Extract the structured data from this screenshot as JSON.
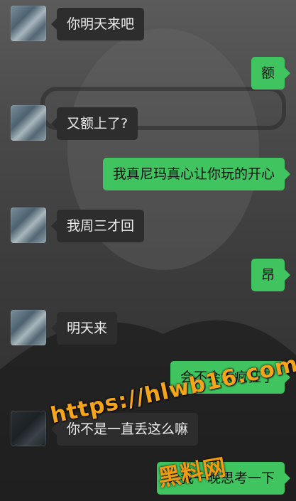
{
  "messages": [
    {
      "side": "in",
      "text": "你明天来吧"
    },
    {
      "side": "out",
      "text": "额"
    },
    {
      "side": "in",
      "text": "又额上了?"
    },
    {
      "side": "out",
      "text": "我真尼玛真心让你玩的开心"
    },
    {
      "side": "in",
      "text": "我周三才回"
    },
    {
      "side": "out",
      "text": "昂"
    },
    {
      "side": "in",
      "text": "明天来"
    },
    {
      "side": "out",
      "text": "会不会太疯狂了"
    },
    {
      "side": "in",
      "text": "你不是一直丢这么嘛"
    },
    {
      "side": "out",
      "text": "给我一晚思考一下"
    }
  ],
  "watermark": {
    "url": "https://hlwb16.com",
    "site_name": "黑料网",
    "color": "#f29a11"
  },
  "colors": {
    "outgoing_bubble": "#3fc45f",
    "incoming_bubble": "#2d2d2d"
  }
}
